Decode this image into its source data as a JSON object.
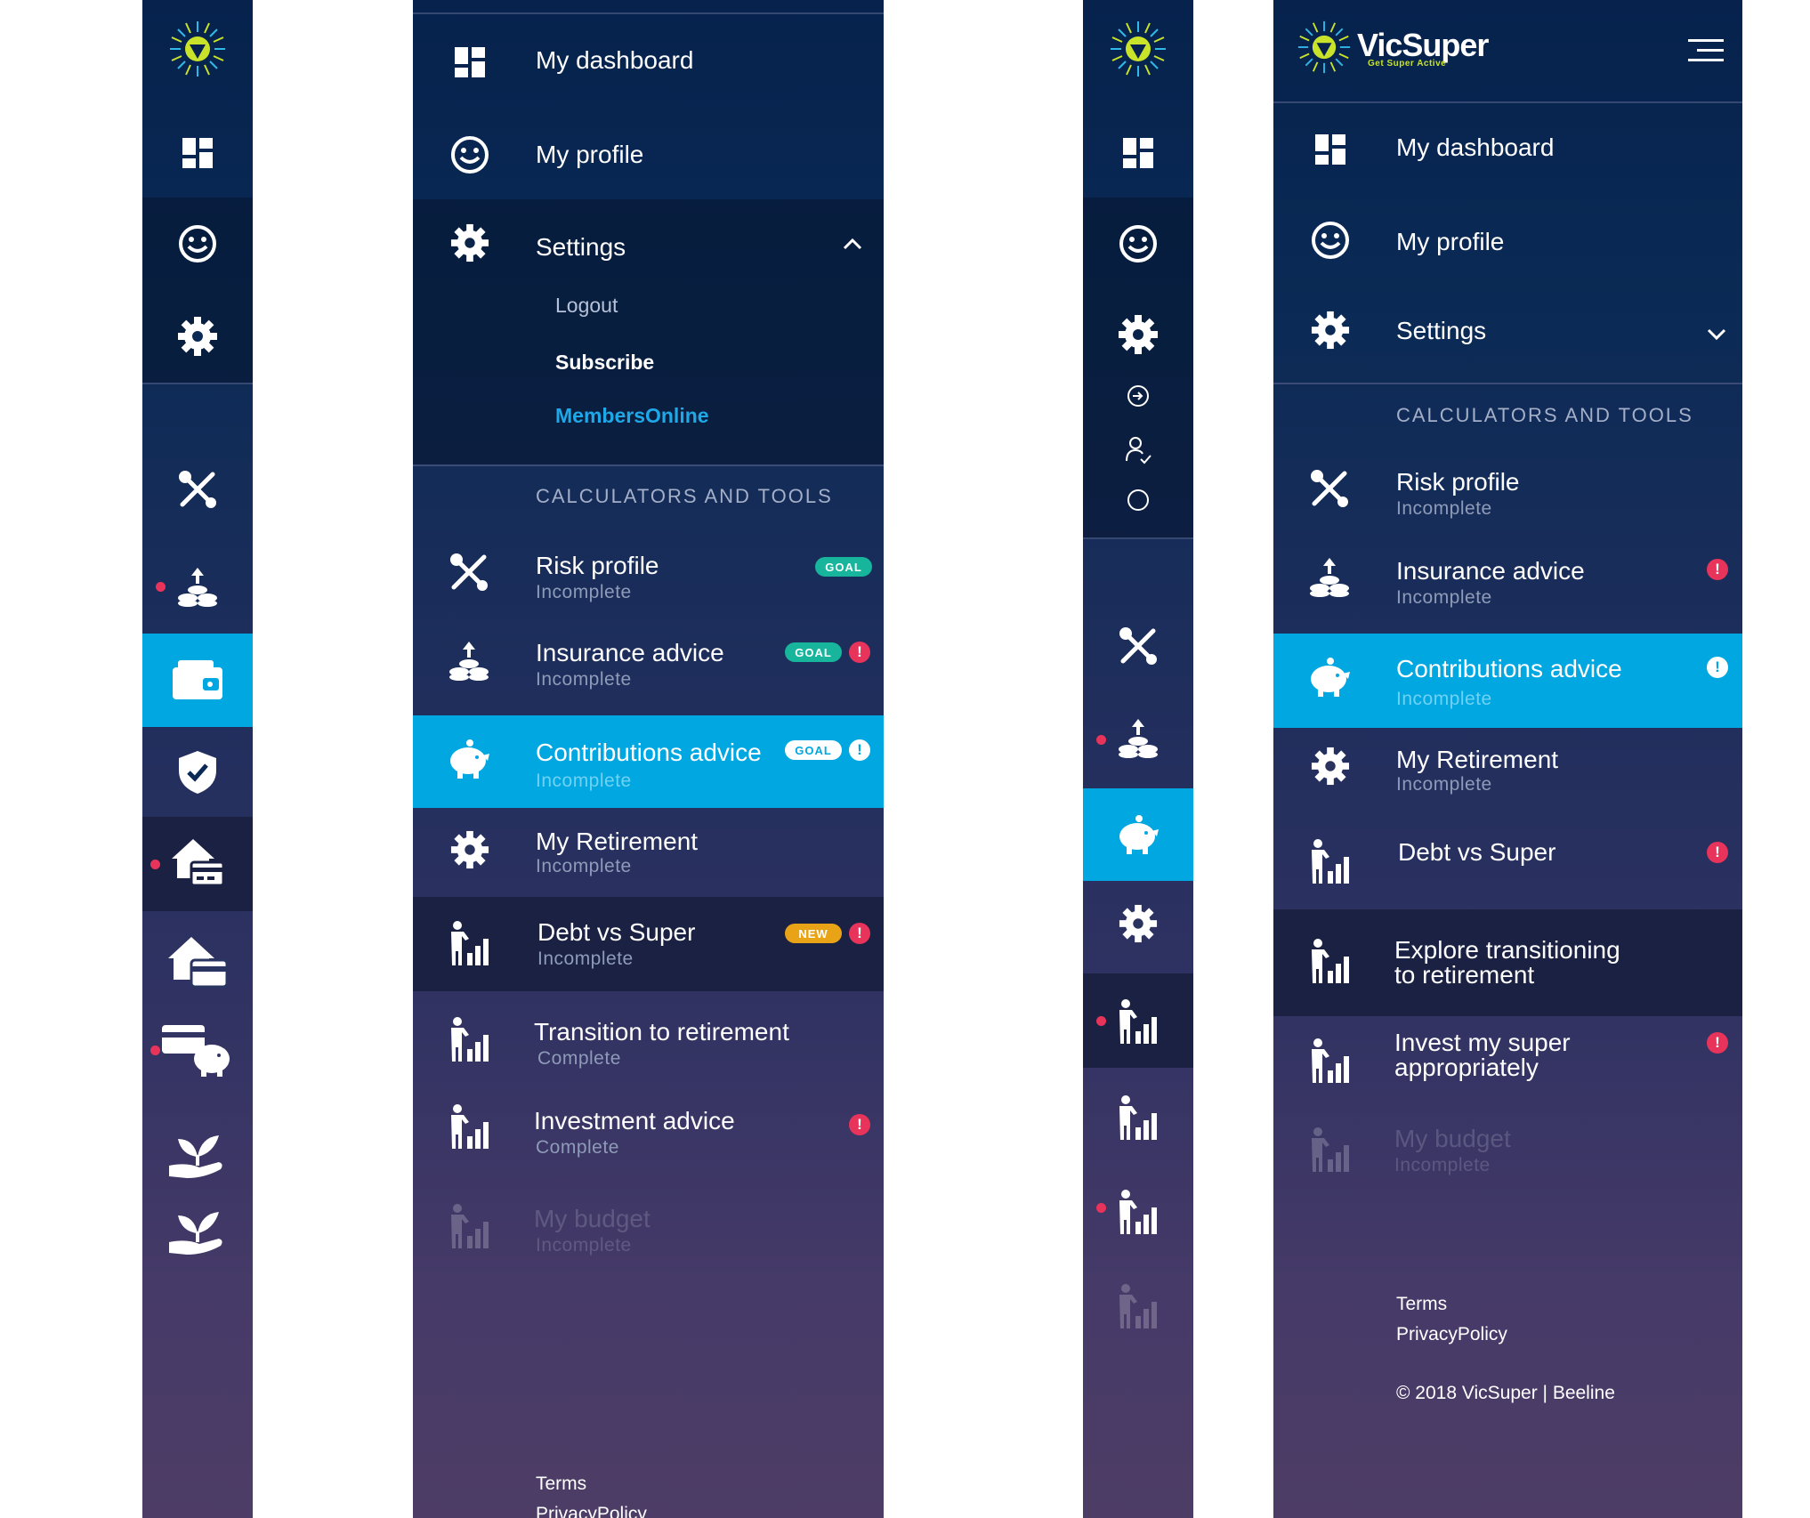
{
  "brand": {
    "name": "VicSuper",
    "tagline": "Get Super Active"
  },
  "nav": {
    "dashboard": "My dashboard",
    "profile": "My profile",
    "settings": "Settings",
    "settings_sub": {
      "logout": "Logout",
      "subscribe": "Subscribe",
      "members": "MembersOnline"
    }
  },
  "section_header": "CALCULATORS AND TOOLS",
  "panel2_tools": [
    {
      "label": "Risk profile",
      "status": "Incomplete",
      "badge": "GOAL"
    },
    {
      "label": "Insurance advice",
      "status": "Incomplete",
      "badge": "GOAL",
      "alert": "!"
    },
    {
      "label": "Contributions advice",
      "status": "Incomplete",
      "badge": "GOAL",
      "alert": "!"
    },
    {
      "label": "My Retirement",
      "status": "Incomplete"
    },
    {
      "label": "Debt vs Super",
      "status": "Incomplete",
      "badge": "NEW",
      "alert": "!"
    },
    {
      "label": "Transition to retirement",
      "status": "Complete"
    },
    {
      "label": "Investment advice",
      "status": "Complete",
      "alert": "!"
    },
    {
      "label": "My budget",
      "status": "Incomplete"
    }
  ],
  "panel4_tools": [
    {
      "label": "Risk profile",
      "status": "Incomplete"
    },
    {
      "label": "Insurance advice",
      "status": "Incomplete",
      "alert": "!"
    },
    {
      "label": "Contributions advice",
      "status": "Incomplete",
      "alert": "!"
    },
    {
      "label": "My Retirement",
      "status": "Incomplete"
    },
    {
      "label": "Debt vs Super",
      "alert": "!"
    },
    {
      "label_line1": "Explore transitioning",
      "label_line2": "to retirement"
    },
    {
      "label_line1": "Invest my super",
      "label_line2": "appropriately",
      "alert": "!"
    },
    {
      "label": "My budget",
      "status": "Incomplete"
    }
  ],
  "footer": {
    "terms": "Terms",
    "privacy": "PrivacyPolicy",
    "copyright": "© 2018 VicSuper | Beeline"
  },
  "colors": {
    "navy": "#06224d",
    "accent": "#00a7e1",
    "alert": "#e8345a",
    "goal": "#17b59b",
    "new": "#e8a317"
  },
  "icons": [
    "logo-icon",
    "dashboard-icon",
    "smiley-icon",
    "gear-icon",
    "tools-icon",
    "coins-icon",
    "wallet-icon",
    "shield-icon",
    "house-card-icon",
    "card-piggy-icon",
    "plant-hand-icon",
    "piggy-icon",
    "person-chart-icon",
    "login-icon",
    "user-check-icon",
    "circle-icon",
    "chevron-up-icon",
    "chevron-down-icon",
    "menu-icon"
  ]
}
